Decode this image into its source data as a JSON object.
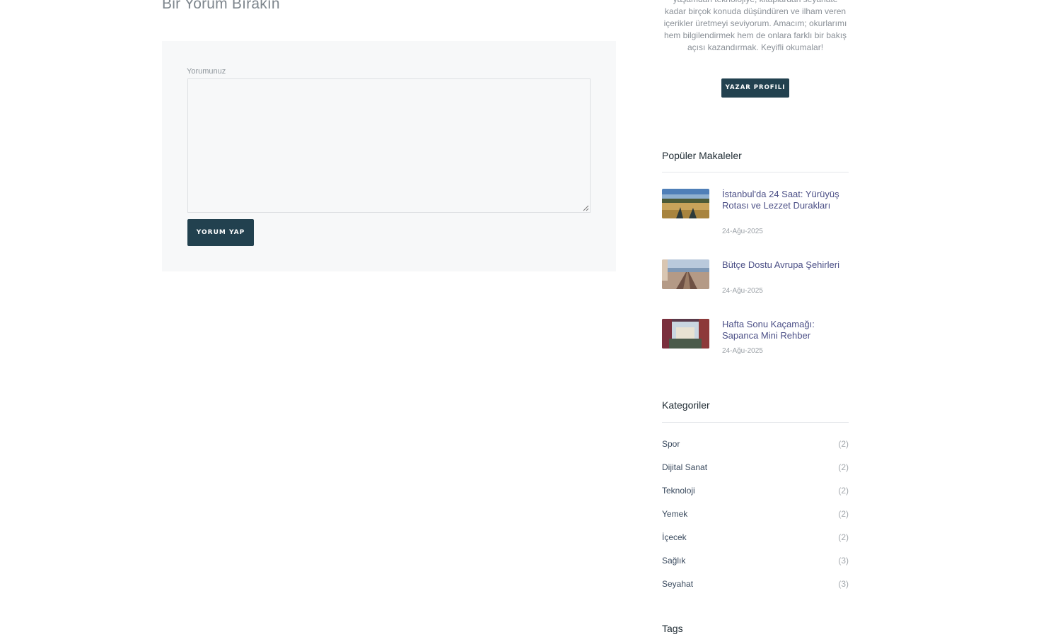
{
  "comment_form": {
    "heading": "Bir Yorum Bırakın",
    "label": "Yorumunuz",
    "textarea_value": "",
    "submit_label": "YORUM YAP"
  },
  "author": {
    "bio": "yaşamdan teknolojiye, kitaplardan seyahate kadar birçok konuda düşündüren ve ilham veren içerikler üretmeyi seviyorum. Amacım; okurlarımı hem bilgilendirmek hem de onlara farklı bir bakış açısı kazandırmak. Keyifli okumalar!",
    "button_label": "YAZAR PROFILI"
  },
  "popular": {
    "title": "Popüler Makaleler",
    "posts": [
      {
        "title": "İstanbul'da 24 Saat: Yürüyüş Rotası ve Lezzet Durakları",
        "date": "24-Ağu-2025"
      },
      {
        "title": "Bütçe Dostu Avrupa Şehirleri",
        "date": "24-Ağu-2025"
      },
      {
        "title": "Hafta Sonu Kaçamağı: Sapanca Mini Rehber",
        "date": "24-Ağu-2025"
      }
    ]
  },
  "categories": {
    "title": "Kategoriler",
    "items": [
      {
        "name": "Spor",
        "count": "(2)"
      },
      {
        "name": "Dijital Sanat",
        "count": "(2)"
      },
      {
        "name": "Teknoloji",
        "count": "(2)"
      },
      {
        "name": "Yemek",
        "count": "(2)"
      },
      {
        "name": "İçecek",
        "count": "(2)"
      },
      {
        "name": "Sağlık",
        "count": "(3)"
      },
      {
        "name": "Seyahat",
        "count": "(3)"
      }
    ]
  },
  "tags": {
    "title": "Tags"
  },
  "colors": {
    "primary_button": "#22414f",
    "link": "#4b4f86",
    "form_background": "#f7f8f9"
  }
}
